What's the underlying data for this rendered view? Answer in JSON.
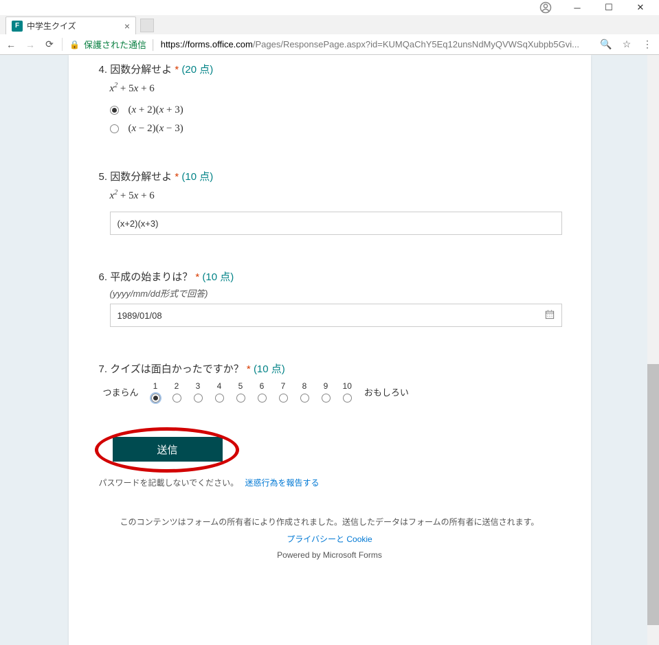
{
  "window": {
    "tab_title": "中学生クイズ",
    "secure_label": "保護された通信",
    "url_host": "https://forms.office.com",
    "url_path": "/Pages/ResponsePage.aspx?id=KUMQaChY5Eq12unsNdMyQVWSqXubpb5Gvi..."
  },
  "q4": {
    "num": "4.",
    "title": "因数分解せよ",
    "req": "*",
    "pts": "(20 点)",
    "expr_html": "x<sup>2</sup> + 5x + 6",
    "opt1_html": "(x + 2)(x + 3)",
    "opt2_html": "(x − 2)(x − 3)"
  },
  "q5": {
    "num": "5.",
    "title": "因数分解せよ",
    "req": "*",
    "pts": "(10 点)",
    "expr_html": "x<sup>2</sup> + 5x + 6",
    "answer": "(x+2)(x+3)"
  },
  "q6": {
    "num": "6.",
    "title": "平成の始まりは？",
    "req": "*",
    "pts": "(10 点)",
    "hint": "(yyyy/mm/dd形式で回答)",
    "answer": "1989/01/08"
  },
  "q7": {
    "num": "7.",
    "title": "クイズは面白かったですか？",
    "req": "*",
    "pts": "(10 点)",
    "left": "つまらん",
    "right": "おもしろい",
    "scale": [
      "1",
      "2",
      "3",
      "4",
      "5",
      "6",
      "7",
      "8",
      "9",
      "10"
    ]
  },
  "submit_label": "送信",
  "pw_note": "パスワードを記載しないでください。",
  "report_abuse": "迷惑行為を報告する",
  "footer": {
    "line1": "このコンテンツはフォームの所有者により作成されました。送信したデータはフォームの所有者に送信されます。",
    "privacy": "プライバシーと Cookie",
    "powered": "Powered by Microsoft Forms"
  }
}
